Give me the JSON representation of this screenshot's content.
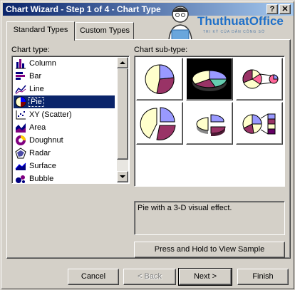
{
  "window": {
    "title": "Chart Wizard - Step 1 of 4 - Chart Type",
    "help_label": "?",
    "close_label": "✕"
  },
  "logo": {
    "name": "ThuthuatOffice",
    "subtitle": "TRI KỶ CỦA DÂN CÔNG SỞ"
  },
  "tabs": [
    {
      "label": "Standard Types",
      "active": true
    },
    {
      "label": "Custom Types",
      "active": false
    }
  ],
  "chart_type_label": "Chart type:",
  "chart_types": [
    {
      "label": "Column",
      "icon": "column-chart-icon"
    },
    {
      "label": "Bar",
      "icon": "bar-chart-icon"
    },
    {
      "label": "Line",
      "icon": "line-chart-icon"
    },
    {
      "label": "Pie",
      "icon": "pie-chart-icon",
      "selected": true
    },
    {
      "label": "XY (Scatter)",
      "icon": "scatter-chart-icon"
    },
    {
      "label": "Area",
      "icon": "area-chart-icon"
    },
    {
      "label": "Doughnut",
      "icon": "doughnut-chart-icon"
    },
    {
      "label": "Radar",
      "icon": "radar-chart-icon"
    },
    {
      "label": "Surface",
      "icon": "surface-chart-icon"
    },
    {
      "label": "Bubble",
      "icon": "bubble-chart-icon"
    }
  ],
  "subtype_label": "Chart sub-type:",
  "subtypes": [
    {
      "name": "pie",
      "selected": false
    },
    {
      "name": "pie-3d",
      "selected": true
    },
    {
      "name": "pie-of-pie",
      "selected": false
    },
    {
      "name": "exploded-pie",
      "selected": false
    },
    {
      "name": "exploded-pie-3d",
      "selected": false
    },
    {
      "name": "bar-of-pie",
      "selected": false
    }
  ],
  "description": "Pie with a 3-D visual effect.",
  "buttons": {
    "view_sample": "Press and Hold to View Sample",
    "cancel": "Cancel",
    "back": "< Back",
    "next": "Next >",
    "finish": "Finish"
  },
  "colors": {
    "title_start": "#0a246a",
    "title_end": "#a6caf0",
    "selection": "#0a246a",
    "slice_purple": "#9999ff",
    "slice_maroon": "#993366",
    "slice_cream": "#ffffcc",
    "slice_teal": "#66ccb0"
  }
}
